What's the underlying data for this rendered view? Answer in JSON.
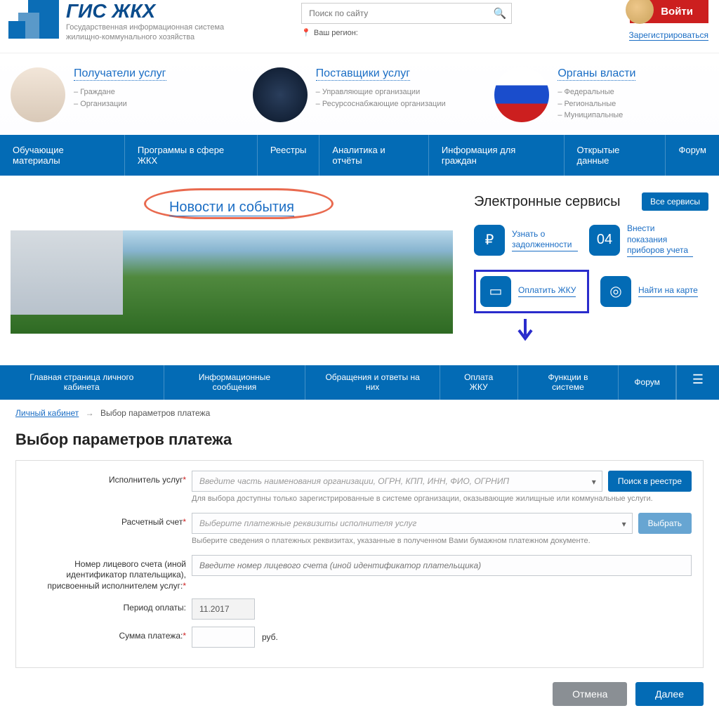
{
  "header": {
    "logo_title": "ГИС ЖКХ",
    "logo_sub1": "Государственная информационная система",
    "logo_sub2": "жилищно-коммунального хозяйства",
    "search_placeholder": "Поиск по сайту",
    "region_label": "Ваш регион:",
    "login": "Войти",
    "register": "Зарегистрироваться"
  },
  "cats": [
    {
      "title": "Получатели услуг",
      "items": [
        "Граждане",
        "Организации"
      ]
    },
    {
      "title": "Поставщики услуг",
      "items": [
        "Управляющие организации",
        "Ресурсоснабжающие организации"
      ]
    },
    {
      "title": "Органы власти",
      "items": [
        "Федеральные",
        "Региональные",
        "Муниципальные"
      ]
    }
  ],
  "nav": [
    "Обучающие материалы",
    "Программы в сфере ЖКХ",
    "Реестры",
    "Аналитика и отчёты",
    "Информация для граждан",
    "Открытые данные",
    "Форум"
  ],
  "news_title": "Новости и события",
  "services": {
    "heading": "Электронные сервисы",
    "all": "Все сервисы",
    "items": [
      {
        "label": "Узнать о задолженности",
        "icon": "₽"
      },
      {
        "label": "Внести показания приборов учета",
        "icon": "04"
      },
      {
        "label": "Оплатить ЖКУ",
        "icon": "▭",
        "highlight": true
      },
      {
        "label": "Найти на карте",
        "icon": "◎"
      }
    ]
  },
  "nav2": [
    "Главная страница личного кабинета",
    "Информационные сообщения",
    "Обращения и ответы на них",
    "Оплата ЖКУ",
    "Функции в системе",
    "Форум"
  ],
  "crumbs": {
    "root": "Личный кабинет",
    "current": "Выбор параметров платежа"
  },
  "page_title": "Выбор параметров платежа",
  "form": {
    "provider_label": "Исполнитель услуг",
    "provider_placeholder": "Введите часть наименования организации, ОГРН, КПП, ИНН, ФИО, ОГРНИП",
    "provider_btn": "Поиск в реестре",
    "provider_hint": "Для выбора доступны только зарегистрированные в системе организации, оказывающие жилищные или коммунальные услуги.",
    "account_label": "Расчетный счет",
    "account_placeholder": "Выберите платежные реквизиты исполнителя услуг",
    "account_btn": "Выбрать",
    "account_hint": "Выберите сведения о платежных реквизитах, указанные в полученном Вами бумажном платежном документе.",
    "personal_label": "Номер лицевого счета (иной идентификатор плательщика), присвоенный исполнителем услуг:",
    "personal_placeholder": "Введите номер лицевого счета (иной идентификатор плательщика)",
    "period_label": "Период оплаты:",
    "period_value": "11.2017",
    "sum_label": "Сумма платежа:",
    "currency": "руб."
  },
  "actions": {
    "cancel": "Отмена",
    "next": "Далее"
  }
}
